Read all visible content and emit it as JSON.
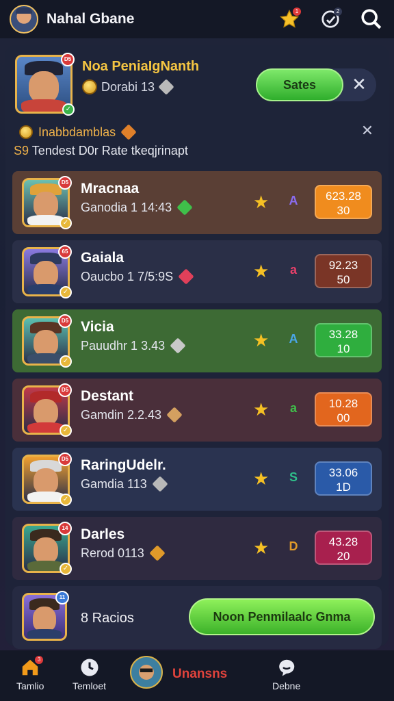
{
  "header": {
    "title": "Nahal Gbane",
    "icons": [
      "profile-avatar",
      "star-icon",
      "target-icon",
      "search-icon"
    ],
    "badges": {
      "star": "1",
      "target": "2"
    }
  },
  "hero": {
    "title": "Noa PeniaIgNanth",
    "sub_text": "Dorabi 13",
    "states_label": "Sates",
    "badge": "D5"
  },
  "notice": {
    "line1": "Inabbdamblas",
    "line2": "Tendest D0r Rate tkeqjrinapt",
    "prefix": "S9"
  },
  "players": [
    {
      "name": "Mracnaa",
      "meta": "Ganodia 1 14:43",
      "rank_icon": "A",
      "score_line1": "623.28",
      "score_line2": "30",
      "badge": "D5",
      "row_color": "#5a3f35",
      "score_color": "#f08c1e",
      "rank_color": "#8a6cf0",
      "cube_color": "#3fbf4a",
      "hat_color": "#e0a23a",
      "shirt_color": "#f2f2f2",
      "bg_tint": "#6dc0b0"
    },
    {
      "name": "Gaiala",
      "meta": "Oaucbo 1 7/5:9S",
      "rank_icon": "a",
      "score_line1": "92.23",
      "score_line2": "50",
      "badge": "65",
      "row_color": "#2a2f47",
      "score_color": "#7a3526",
      "rank_color": "#e8406a",
      "cube_color": "#e0405a",
      "hat_color": "#2d3a5e",
      "shirt_color": "#2a3e6a",
      "bg_tint": "#8a7ae0"
    },
    {
      "name": "Vicia",
      "meta": "Pauudhr 1 3.43",
      "rank_icon": "A",
      "score_line1": "33.28",
      "score_line2": "10",
      "badge": "D5",
      "row_color": "#3d6a34",
      "score_color": "#2fae3e",
      "rank_color": "#4aa6e8",
      "cube_color": "#c8c8c8",
      "hat_color": "#5a3424",
      "shirt_color": "#3a4e6a",
      "bg_tint": "#5cc0b0"
    },
    {
      "name": "Destant",
      "meta": "Gamdin 2.2.43",
      "rank_icon": "a",
      "score_line1": "10.28",
      "score_line2": "00",
      "badge": "D5",
      "row_color": "#4a2f3a",
      "score_color": "#e2661e",
      "rank_color": "#3fbf4a",
      "cube_color": "#d4a060",
      "hat_color": "#b22a2a",
      "shirt_color": "#d23a3a",
      "bg_tint": "#c03a4a"
    },
    {
      "name": "RaringUdelr.",
      "meta": "Gamdia 113",
      "rank_icon": "S",
      "score_line1": "33.06",
      "score_line2": "1D",
      "badge": "D5",
      "row_color": "#2a3350",
      "score_color": "#2a5aa8",
      "rank_color": "#2fbf8a",
      "cube_color": "#b8b8b8",
      "hat_color": "#d8d8d8",
      "shirt_color": "#f2f2f2",
      "bg_tint": "#f0a030"
    },
    {
      "name": "Darles",
      "meta": "Rerod 0113",
      "rank_icon": "D",
      "score_line1": "43.28",
      "score_line2": "20",
      "badge": "14",
      "row_color": "#2f2a40",
      "score_color": "#a8204e",
      "rank_color": "#e09a2a",
      "cube_color": "#e09a2a",
      "hat_color": "#3a2a1e",
      "shirt_color": "#5a6a3a",
      "bg_tint": "#3aa890"
    }
  ],
  "bottom_card": {
    "label": "8 Racios",
    "button_label": "Noon Penmilaalc Gnma",
    "badge": "11"
  },
  "nav": {
    "items": [
      {
        "label": "Tamlio"
      },
      {
        "label": "Temloet"
      },
      {
        "label": "Unansns"
      },
      {
        "label": "Debne"
      }
    ],
    "home_badge": "3"
  }
}
